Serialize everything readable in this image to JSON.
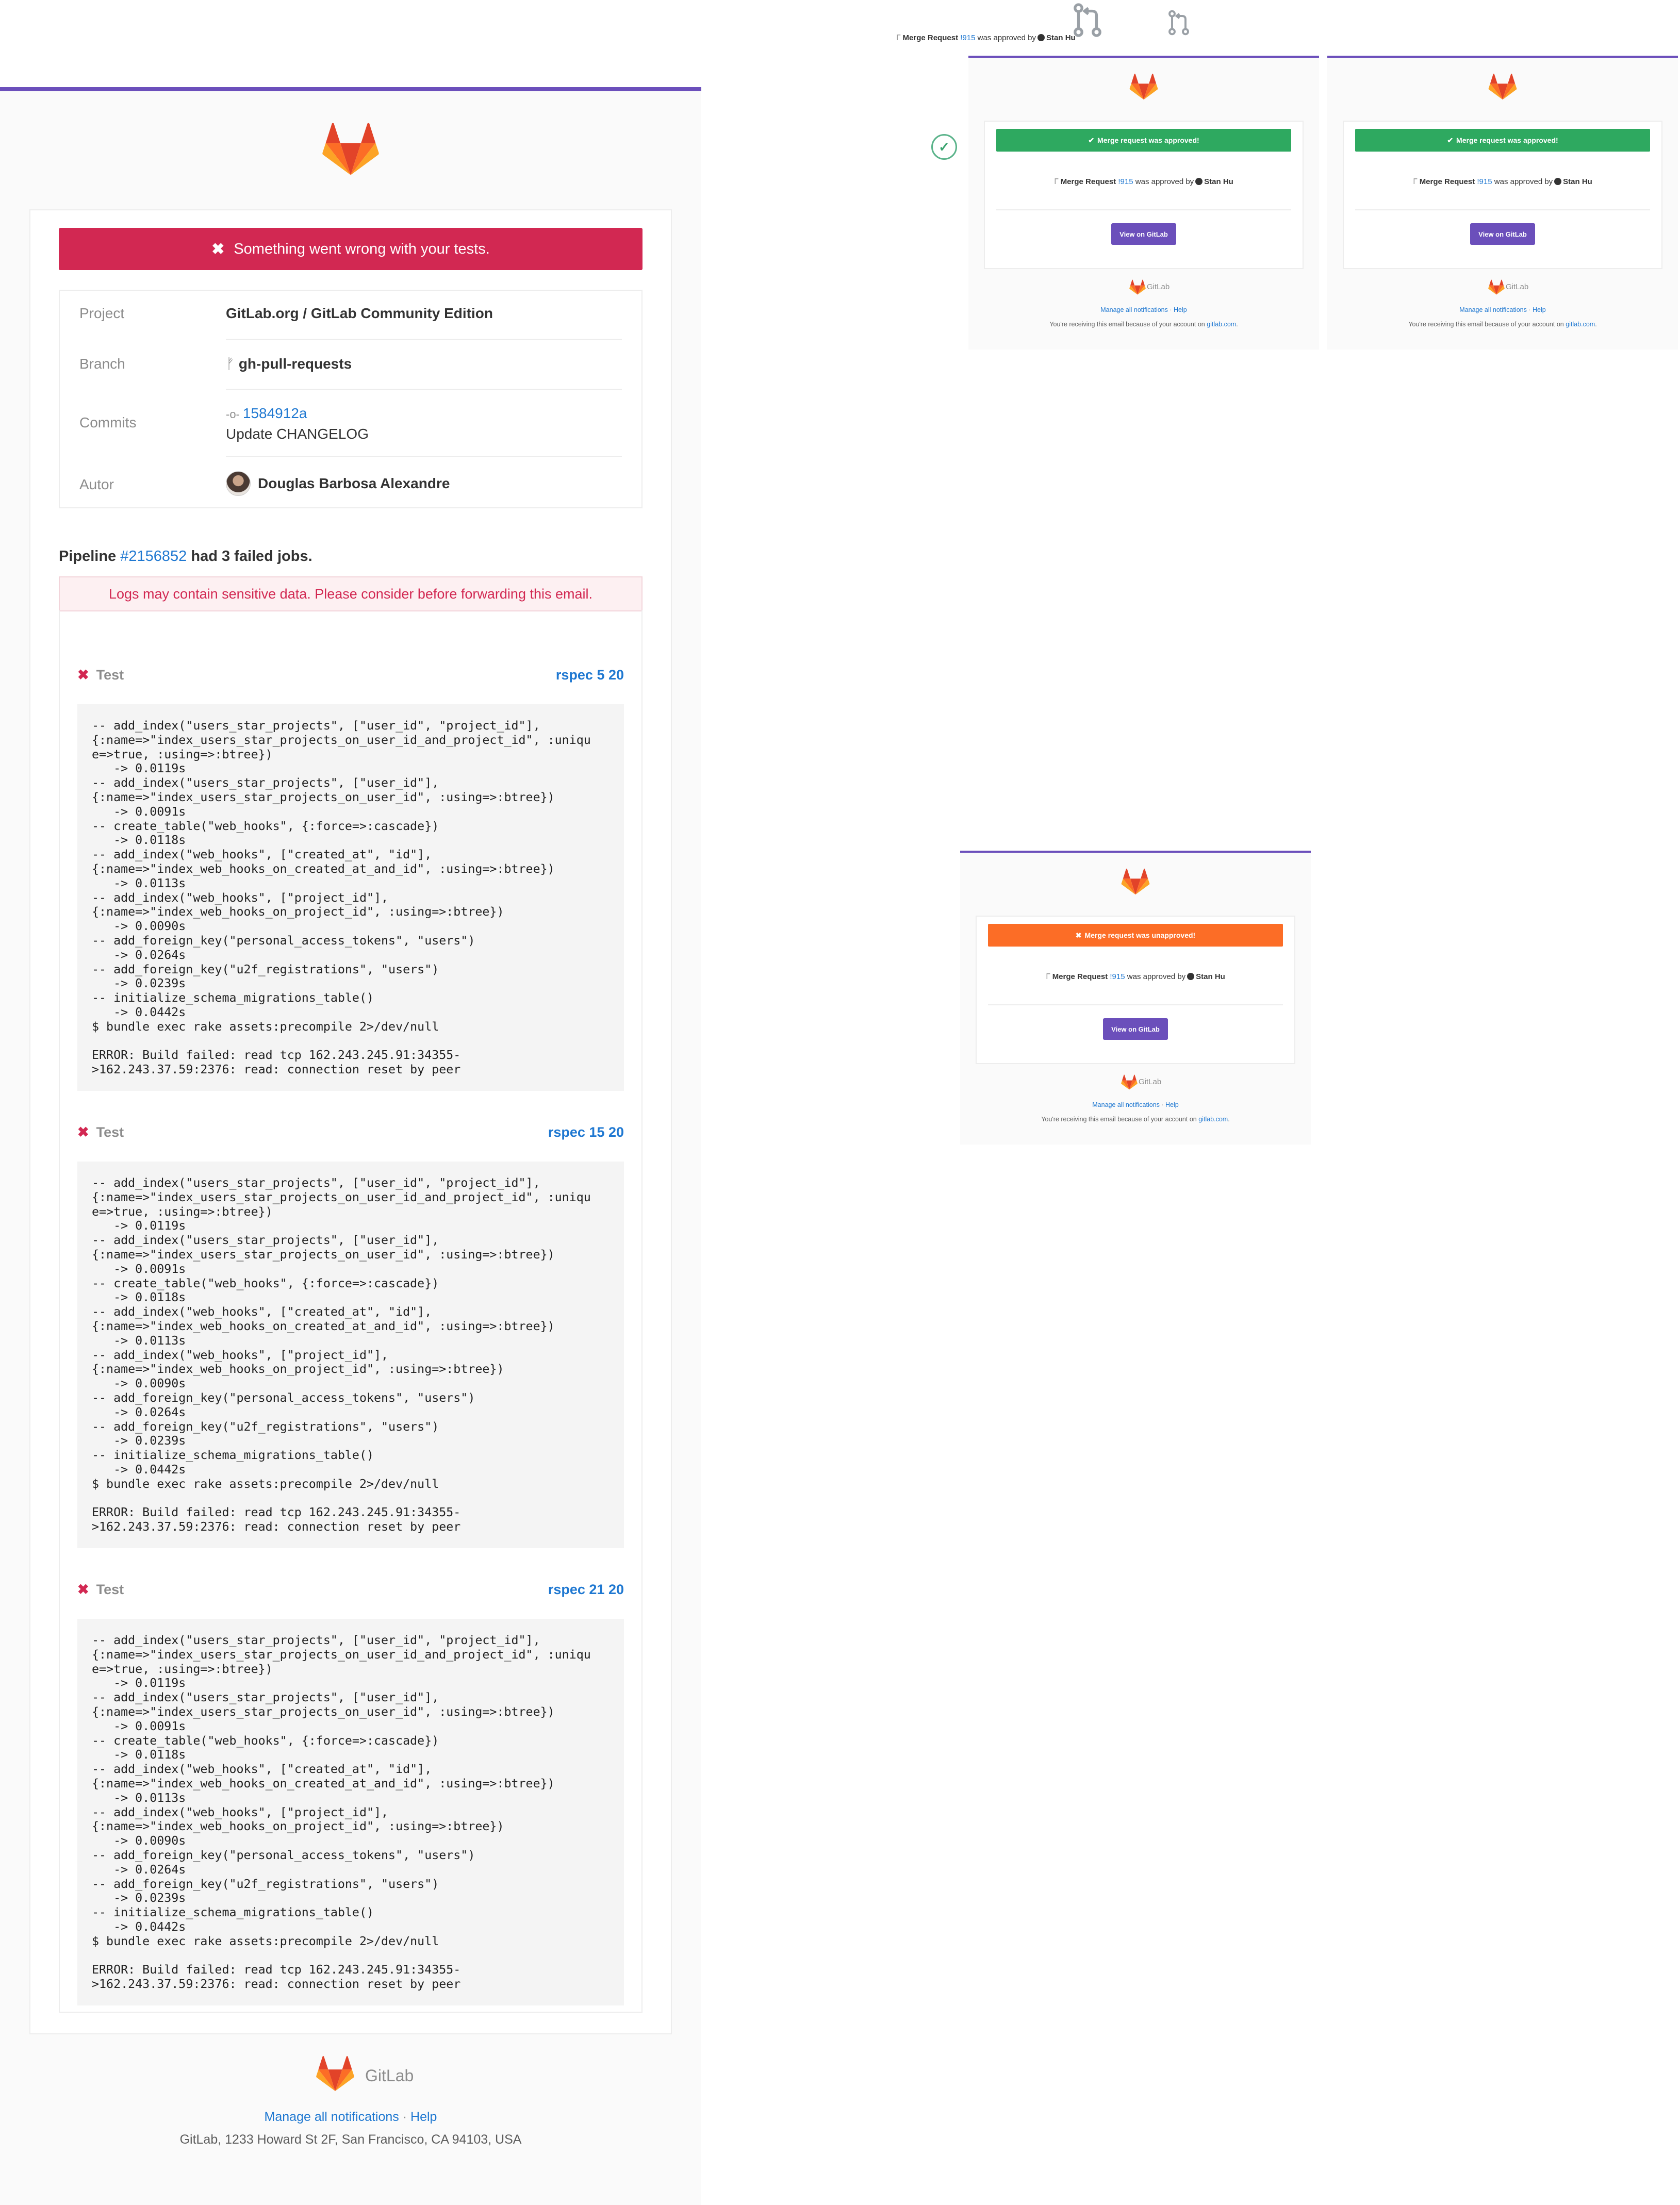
{
  "main_email": {
    "alert_text": "Something went wrong with your tests.",
    "info": {
      "project_label": "Project",
      "project_value": "GitLab.org / GitLab Community Edition",
      "branch_label": "Branch",
      "branch_value": "gh-pull-requests",
      "commits_label": "Commits",
      "commit_sha": "1584912a",
      "commit_message": "Update CHANGELOG",
      "author_label": "Autor",
      "author_value": "Douglas Barbosa Alexandre"
    },
    "pipeline": {
      "prefix": "Pipeline",
      "id": "#2156852",
      "suffix": "had 3 failed jobs."
    },
    "warning": "Logs may contain sensitive data. Please consider before forwarding this email.",
    "jobs": [
      {
        "stage": "Test",
        "name": "rspec 5 20"
      },
      {
        "stage": "Test",
        "name": "rspec 15 20"
      },
      {
        "stage": "Test",
        "name": "rspec 21 20"
      }
    ],
    "log_text": "-- add_index(\"users_star_projects\", [\"user_id\", \"project_id\"],\n{:name=>\"index_users_star_projects_on_user_id_and_project_id\", :uniqu\ne=>true, :using=>:btree})\n   -> 0.0119s\n-- add_index(\"users_star_projects\", [\"user_id\"],\n{:name=>\"index_users_star_projects_on_user_id\", :using=>:btree})\n   -> 0.0091s\n-- create_table(\"web_hooks\", {:force=>:cascade})\n   -> 0.0118s\n-- add_index(\"web_hooks\", [\"created_at\", \"id\"],\n{:name=>\"index_web_hooks_on_created_at_and_id\", :using=>:btree})\n   -> 0.0113s\n-- add_index(\"web_hooks\", [\"project_id\"],\n{:name=>\"index_web_hooks_on_project_id\", :using=>:btree})\n   -> 0.0090s\n-- add_foreign_key(\"personal_access_tokens\", \"users\")\n   -> 0.0264s\n-- add_foreign_key(\"u2f_registrations\", \"users\")\n   -> 0.0239s\n-- initialize_schema_migrations_table()\n   -> 0.0442s\n$ bundle exec rake assets:precompile 2>/dev/null\n\nERROR: Build failed: read tcp 162.243.245.91:34355-\n>162.243.37.59:2376: read: connection reset by peer",
    "footer": {
      "brand": "GitLab",
      "manage": "Manage all notifications",
      "dot": "·",
      "help": "Help",
      "address": "GitLab, 1233 Howard St 2F, San Francisco, CA 94103, USA"
    }
  },
  "top_line": {
    "prefix": "Merge Request",
    "mr": "!915",
    "middle": "was approved by",
    "user": "Stan Hu"
  },
  "mini_emails": [
    {
      "banner": "Merge request was approved!",
      "banner_color": "#2ea960"
    },
    {
      "banner": "Merge request was approved!",
      "banner_color": "#2ea960"
    },
    {
      "banner": "Merge request was unapproved!",
      "banner_color": "#fc6d26"
    }
  ],
  "mini_common": {
    "line_prefix": "Merge Request",
    "mr": "!915",
    "line_middle": "was approved by",
    "user": "Stan Hu",
    "button": "View on GitLab",
    "brand": "GitLab",
    "manage": "Manage all notifications",
    "dot": "·",
    "help": "Help",
    "receiving_prefix": "You're receiving this email because of your account on",
    "receiving_link": "gitlab.com",
    "receiving_suffix": "."
  },
  "colors": {
    "accent": "#6b4fbb",
    "danger": "#d22852",
    "link": "#1f78d1"
  }
}
